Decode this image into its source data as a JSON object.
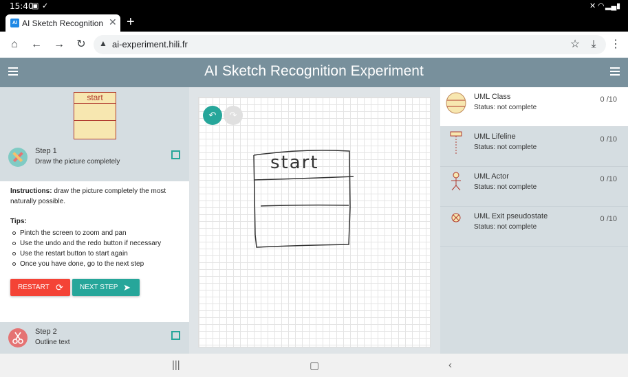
{
  "status_bar": {
    "time": "15:40"
  },
  "browser": {
    "tab_title": "AI Sketch Recognition Experiment",
    "favicon_text": "AI",
    "url": "ai-experiment.hili.fr"
  },
  "app": {
    "title": "AI Sketch Recognition Experiment"
  },
  "preview": {
    "class_name": "start"
  },
  "steps": [
    {
      "title": "Step 1",
      "subtitle": "Draw the picture completely"
    },
    {
      "title": "Step 2",
      "subtitle": "Outline text"
    }
  ],
  "instructions": {
    "label": "Instructions:",
    "text": "draw the picture completely the most naturally possible.",
    "tips_title": "Tips:",
    "tips": [
      "Pintch the screen to zoom and pan",
      "Use the undo and the redo button if necessary",
      "Use the restart button to start again",
      "Once you have done, go to the next step"
    ]
  },
  "buttons": {
    "restart": "RESTART",
    "next_step": "NEXT STEP"
  },
  "canvas": {
    "sketch_text": "start"
  },
  "uml_items": [
    {
      "name": "UML Class",
      "status": "Status: not complete",
      "count": "0 /10",
      "icon": "uml-class-icon"
    },
    {
      "name": "UML Lifeline",
      "status": "Status: not complete",
      "count": "0 /10",
      "icon": "uml-lifeline-icon"
    },
    {
      "name": "UML Actor",
      "status": "Status: not complete",
      "count": "0 /10",
      "icon": "uml-actor-icon"
    },
    {
      "name": "UML Exit pseudostate",
      "status": "Status: not complete",
      "count": "0 /10",
      "icon": "uml-exit-icon"
    }
  ],
  "colors": {
    "header": "#78909c",
    "panel": "#d5dde1",
    "accent": "#26a69a",
    "restart": "#f44336",
    "uml_fill": "#f7e7b0",
    "uml_stroke": "#b03a2e"
  }
}
